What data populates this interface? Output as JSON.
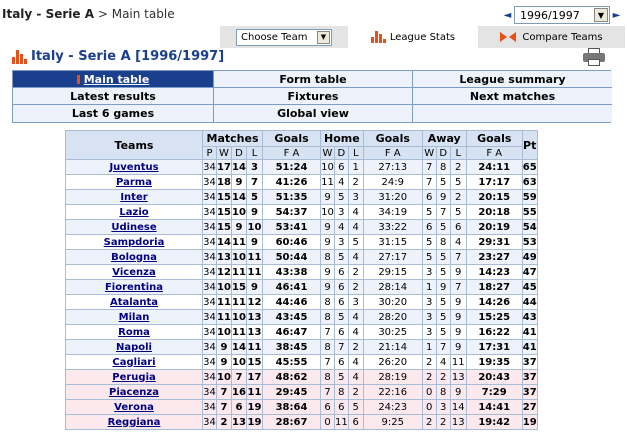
{
  "breadcrumb": {
    "root": "Italy - Serie A",
    "sep": ">",
    "current": "Main table"
  },
  "season": {
    "value": "1996/1997",
    "prev_icon": "◄",
    "next_icon": "►"
  },
  "tabs": {
    "choose_team": "Choose Team",
    "league_stats": "League Stats",
    "compare_teams": "Compare Teams"
  },
  "title": "Italy - Serie A [1996/1997]",
  "nav": [
    "Main table",
    "Form table",
    "League summary",
    "Latest results",
    "Fixtures",
    "Next matches",
    "Last 6 games",
    "Global view",
    ""
  ],
  "table": {
    "headers": {
      "teams": "Teams",
      "matches": "Matches",
      "goals": "Goals",
      "home": "Home",
      "home_goals": "Goals",
      "away": "Away",
      "away_goals": "Goals",
      "pt": "Pt",
      "p": "P",
      "w": "W",
      "d": "D",
      "l": "L",
      "fa": "F A"
    },
    "rows": [
      [
        "Juventus",
        "34",
        "17",
        "14",
        "3",
        "51:24",
        "10",
        "6",
        "1",
        "27:13",
        "7",
        "8",
        "2",
        "24:11",
        "65"
      ],
      [
        "Parma",
        "34",
        "18",
        "9",
        "7",
        "41:26",
        "11",
        "4",
        "2",
        "24:9",
        "7",
        "5",
        "5",
        "17:17",
        "63"
      ],
      [
        "Inter",
        "34",
        "15",
        "14",
        "5",
        "51:35",
        "9",
        "5",
        "3",
        "31:20",
        "6",
        "9",
        "2",
        "20:15",
        "59"
      ],
      [
        "Lazio",
        "34",
        "15",
        "10",
        "9",
        "54:37",
        "10",
        "3",
        "4",
        "34:19",
        "5",
        "7",
        "5",
        "20:18",
        "55"
      ],
      [
        "Udinese",
        "34",
        "15",
        "9",
        "10",
        "53:41",
        "9",
        "4",
        "4",
        "33:22",
        "6",
        "5",
        "6",
        "20:19",
        "54"
      ],
      [
        "Sampdoria",
        "34",
        "14",
        "11",
        "9",
        "60:46",
        "9",
        "3",
        "5",
        "31:15",
        "5",
        "8",
        "4",
        "29:31",
        "53"
      ],
      [
        "Bologna",
        "34",
        "13",
        "10",
        "11",
        "50:44",
        "8",
        "5",
        "4",
        "27:17",
        "5",
        "5",
        "7",
        "23:27",
        "49"
      ],
      [
        "Vicenza",
        "34",
        "12",
        "11",
        "11",
        "43:38",
        "9",
        "6",
        "2",
        "29:15",
        "3",
        "5",
        "9",
        "14:23",
        "47"
      ],
      [
        "Fiorentina",
        "34",
        "10",
        "15",
        "9",
        "46:41",
        "9",
        "6",
        "2",
        "28:14",
        "1",
        "9",
        "7",
        "18:27",
        "45"
      ],
      [
        "Atalanta",
        "34",
        "11",
        "11",
        "12",
        "44:46",
        "8",
        "6",
        "3",
        "30:20",
        "3",
        "5",
        "9",
        "14:26",
        "44"
      ],
      [
        "Milan",
        "34",
        "11",
        "10",
        "13",
        "43:45",
        "8",
        "5",
        "4",
        "28:20",
        "3",
        "5",
        "9",
        "15:25",
        "43"
      ],
      [
        "Roma",
        "34",
        "10",
        "11",
        "13",
        "46:47",
        "7",
        "6",
        "4",
        "30:25",
        "3",
        "5",
        "9",
        "16:22",
        "41"
      ],
      [
        "Napoli",
        "34",
        "9",
        "14",
        "11",
        "38:45",
        "8",
        "7",
        "2",
        "21:14",
        "1",
        "7",
        "9",
        "17:31",
        "41"
      ],
      [
        "Cagliari",
        "34",
        "9",
        "10",
        "15",
        "45:55",
        "7",
        "6",
        "4",
        "26:20",
        "2",
        "4",
        "11",
        "19:35",
        "37"
      ],
      [
        "Perugia",
        "34",
        "10",
        "7",
        "17",
        "48:62",
        "8",
        "5",
        "4",
        "28:19",
        "2",
        "2",
        "13",
        "20:43",
        "37"
      ],
      [
        "Piacenza",
        "34",
        "7",
        "16",
        "11",
        "29:45",
        "7",
        "8",
        "2",
        "22:16",
        "0",
        "8",
        "9",
        "7:29",
        "37"
      ],
      [
        "Verona",
        "34",
        "7",
        "6",
        "19",
        "38:64",
        "6",
        "6",
        "5",
        "24:23",
        "0",
        "3",
        "14",
        "14:41",
        "27"
      ],
      [
        "Reggiana",
        "34",
        "2",
        "13",
        "19",
        "28:67",
        "0",
        "11",
        "6",
        "9:25",
        "2",
        "2",
        "13",
        "19:42",
        "19"
      ]
    ],
    "relegated_from": 14
  }
}
